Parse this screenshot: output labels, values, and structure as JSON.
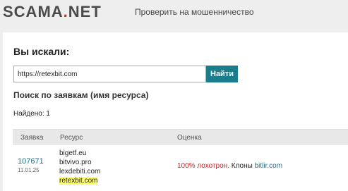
{
  "header": {
    "logo_left": "SCAMA",
    "logo_dot": ".",
    "logo_right": "NET",
    "nav_link": "Проверить на мошенничество"
  },
  "search": {
    "heading": "Вы искали:",
    "value": "https://retexbit.com",
    "button_label": "Найти"
  },
  "results": {
    "heading": "Поиск по заявкам (имя ресурса)",
    "found_label": "Найдено: 1",
    "columns": [
      "Заявка",
      "Ресурс",
      "Оценка"
    ],
    "rows": [
      {
        "request_id": "107671",
        "date": "11.01.25",
        "resources": [
          "bigetf.eu",
          "bitvivo.pro",
          "lexdebiti.com",
          "retexbit.com"
        ],
        "rating_scam": "100% лохотрон.",
        "rating_clones": "Клоны",
        "rating_link": "bitlir.com"
      }
    ]
  },
  "colors": {
    "accent": "#1a7d8c",
    "logo_dot": "#c8312b",
    "scam_red": "#d42020",
    "highlight": "#ffff66",
    "link": "#1f6f8b"
  }
}
